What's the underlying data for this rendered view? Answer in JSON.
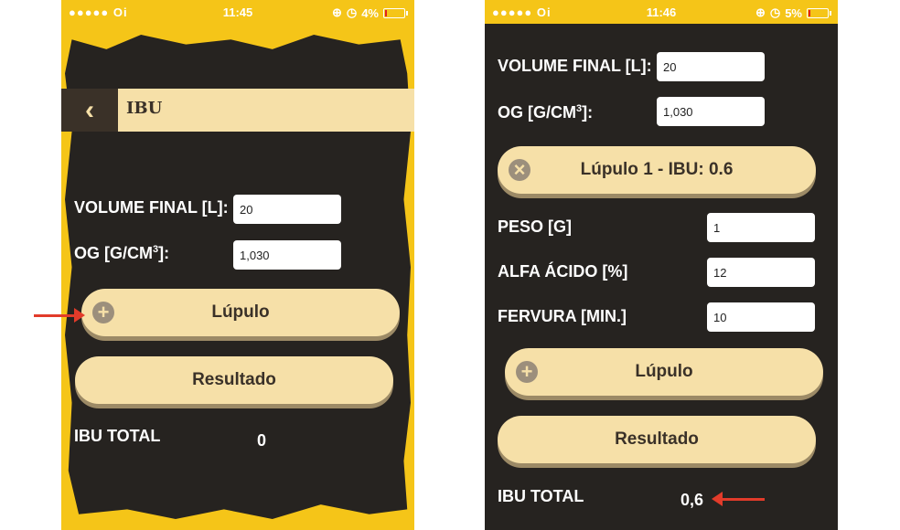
{
  "left": {
    "status": {
      "signal": "●●●●● Oi",
      "time": "11:45",
      "battery": "4%"
    },
    "header_title": "IBU",
    "volume_label": "VOLUME FINAL [L]:",
    "volume_value": "20",
    "og_label": "OG [G/CM",
    "og_sup": "3",
    "og_suffix": "]:",
    "og_value": "1,030",
    "lupulo_button": "Lúpulo",
    "resultado_button": "Resultado",
    "ibu_total_label": "IBU TOTAL",
    "ibu_total_value": "0"
  },
  "right": {
    "status": {
      "signal": "●●●●● Oi",
      "time": "11:46",
      "battery": "5%"
    },
    "volume_label": "VOLUME FINAL [L]:",
    "volume_value": "20",
    "og_label": "OG [G/CM",
    "og_sup": "3",
    "og_suffix": "]:",
    "og_value": "1,030",
    "hop1_header": "Lúpulo 1 - IBU: 0.6",
    "peso_label": "PESO [G]",
    "peso_value": "1",
    "alfa_label": "ALFA ÁCIDO [%]",
    "alfa_value": "12",
    "fervura_label": "FERVURA [MIN.]",
    "fervura_value": "10",
    "lupulo_button": "Lúpulo",
    "resultado_button": "Resultado",
    "ibu_total_label": "IBU TOTAL",
    "ibu_total_value": "0,6"
  },
  "icons": {
    "back": "‹",
    "plus": "+",
    "close": "×",
    "wifi": "wifi-icon",
    "lock": "lock-icon",
    "alarm": "alarm-icon"
  },
  "colors": {
    "yellow": "#f5c518",
    "dark": "#262320",
    "cream": "#f6e0a8",
    "arrow": "#e23b2a"
  }
}
